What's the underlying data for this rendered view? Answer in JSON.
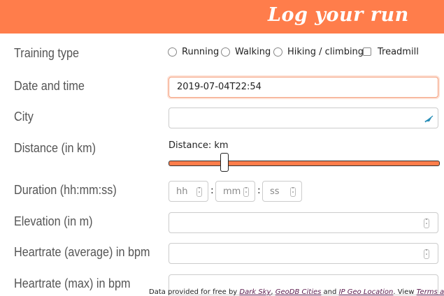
{
  "header": {
    "title": "Log your run",
    "color": "#ff7d4b"
  },
  "form": {
    "training_type": {
      "label": "Training type",
      "options": [
        "Running",
        "Walking",
        "Hiking / climbing"
      ],
      "checkbox_label": "Treadmill"
    },
    "date_time": {
      "label": "Date and time",
      "value": "2019-07-04T22:54"
    },
    "city": {
      "label": "City",
      "value": "",
      "icon": "location-arrow-icon"
    },
    "distance": {
      "label": "Distance (in km)",
      "caption": "Distance: km",
      "level_fraction": 0.21
    },
    "duration": {
      "label": "Duration (hh:mm:ss)",
      "hh_placeholder": "hh",
      "mm_placeholder": "mm",
      "ss_placeholder": "ss",
      "separator": ":"
    },
    "elevation": {
      "label": "Elevation (in m)",
      "value": ""
    },
    "heartrate_avg": {
      "label": "Heartrate (average) in bpm",
      "value": ""
    },
    "heartrate_max": {
      "label": "Heartrate (max) in bpm",
      "value": ""
    }
  },
  "footer": {
    "prefix": "Data provided for free by",
    "link1": "Dark Sky",
    "sep1": ",",
    "link2": "GeoDB Cities",
    "and": "and",
    "link3": "IP Geo Location",
    "suffix": ". View",
    "link4": "Terms and c"
  }
}
